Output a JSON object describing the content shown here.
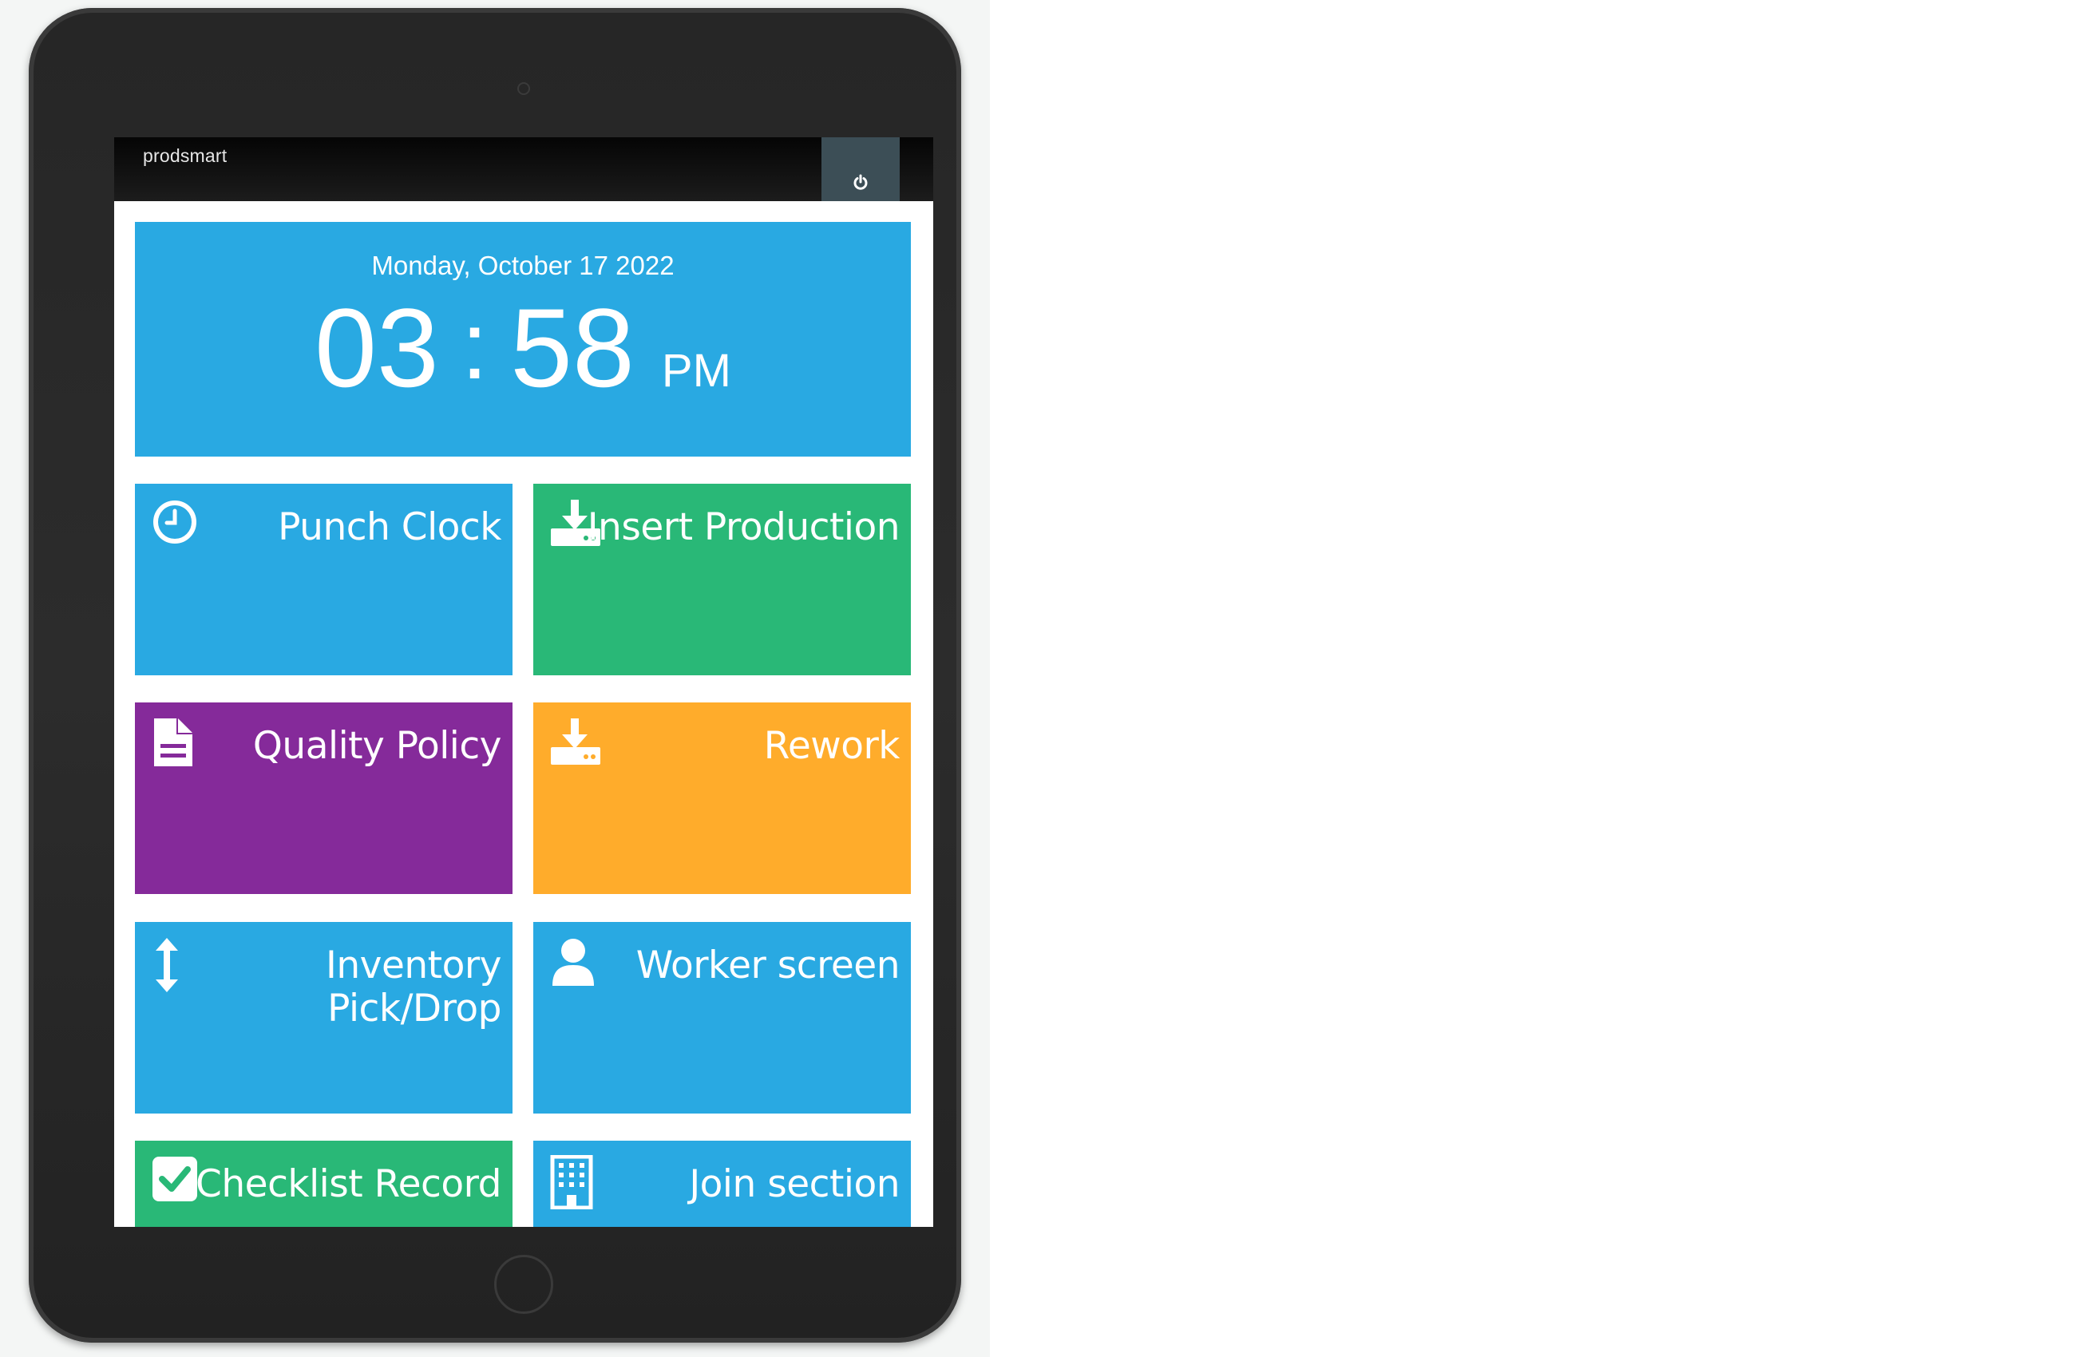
{
  "app": {
    "brand": "prodsmart"
  },
  "clock": {
    "date": "Monday, October 17 2022",
    "hours": "03",
    "separator": ":",
    "minutes": "58",
    "ampm": "PM"
  },
  "tiles": [
    {
      "label": "Punch Clock",
      "icon": "clock-icon",
      "color": "#29a9e2"
    },
    {
      "label": "Insert Production",
      "icon": "download-icon",
      "color": "#29b877"
    },
    {
      "label": "Quality Policy",
      "icon": "document-icon",
      "color": "#852a9a"
    },
    {
      "label": "Rework",
      "icon": "download-icon",
      "color": "#ffac2b"
    },
    {
      "label": "Inventory Pick/Drop",
      "icon": "vertical-arrows-icon",
      "color": "#29a9e2"
    },
    {
      "label": "Worker screen",
      "icon": "user-icon",
      "color": "#29a9e2"
    },
    {
      "label": "Checklist Record",
      "icon": "checkbox-icon",
      "color": "#29b877"
    },
    {
      "label": "Join section",
      "icon": "building-icon",
      "color": "#29a9e2"
    }
  ],
  "header": {
    "power_icon": "power-icon"
  }
}
